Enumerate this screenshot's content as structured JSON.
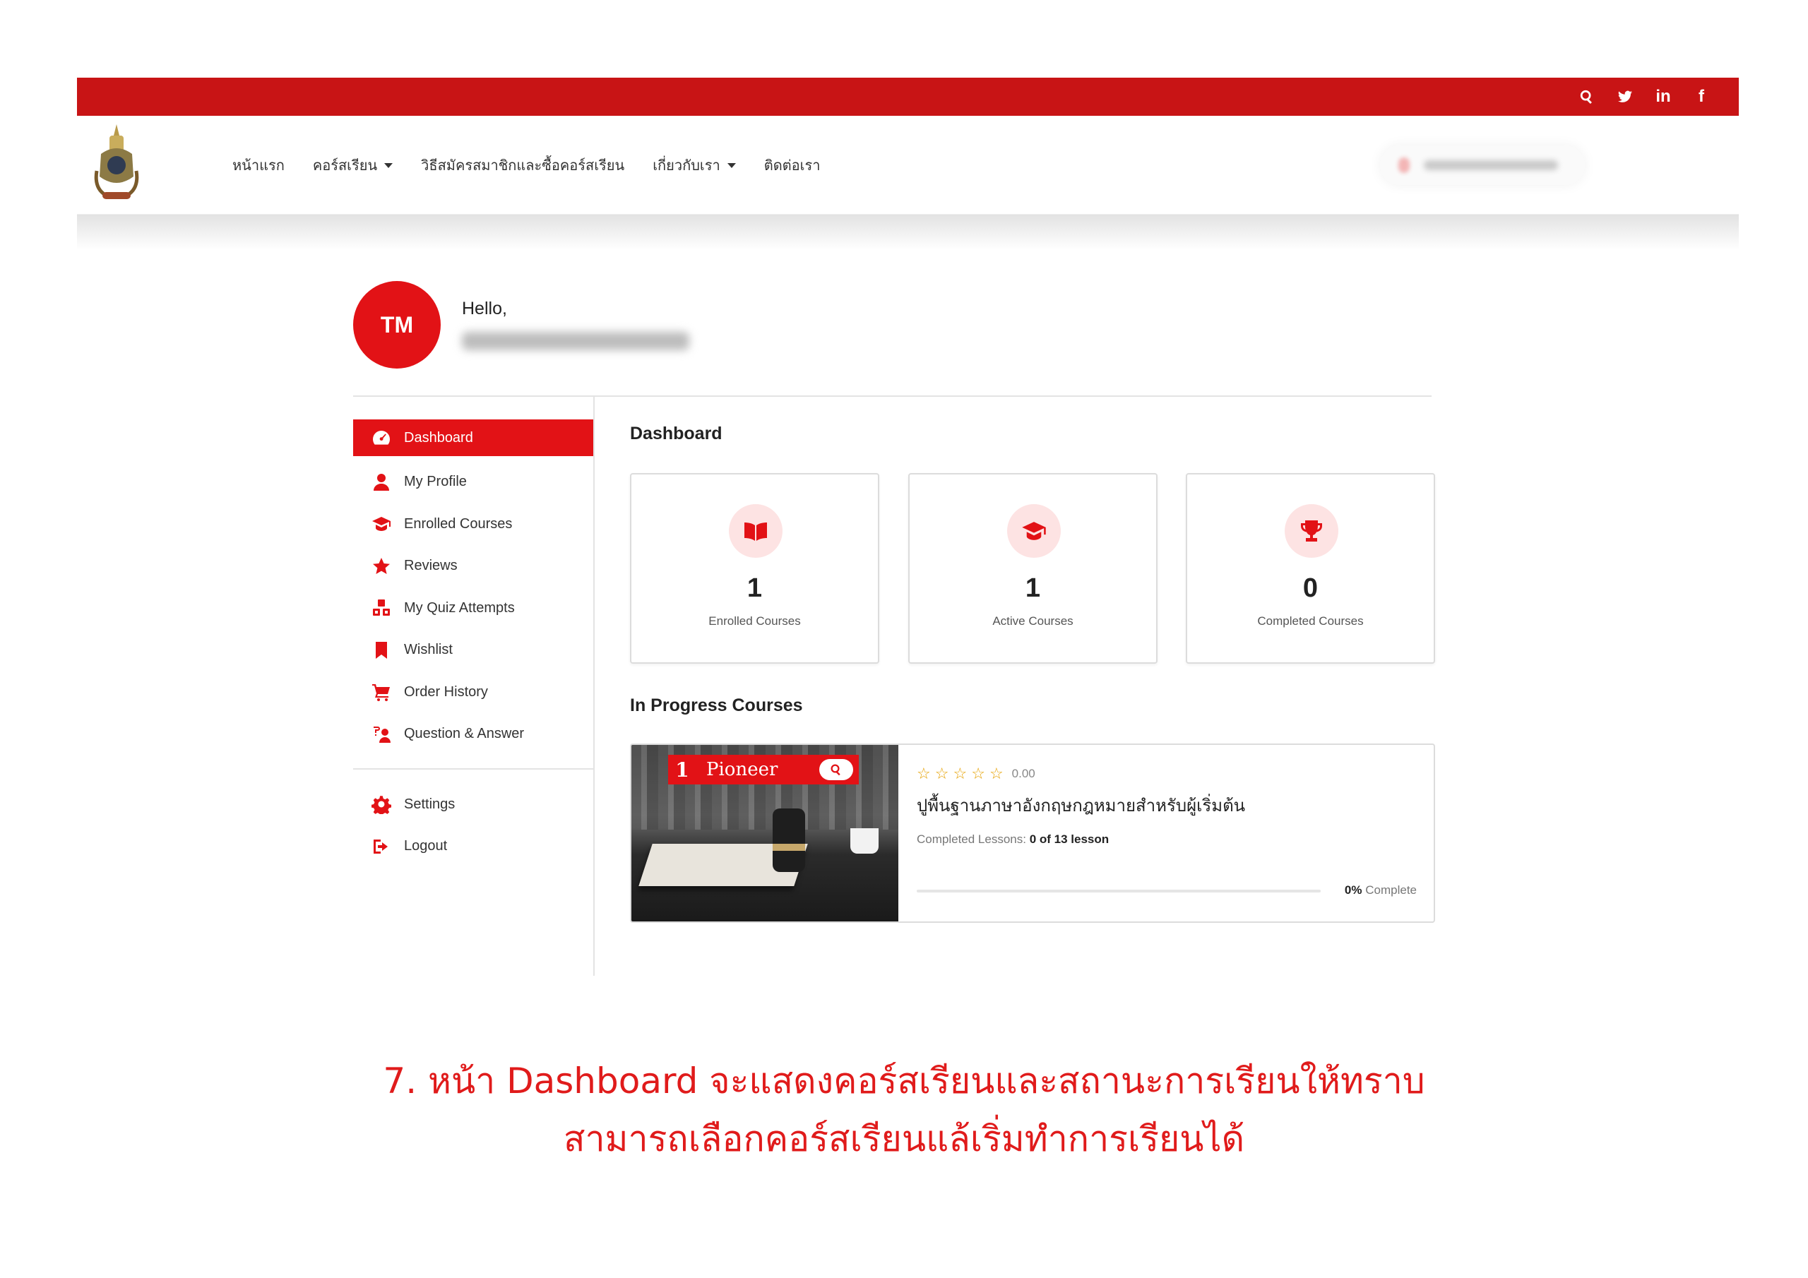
{
  "colors": {
    "brand_red": "#c81415",
    "accent_red": "#e21216",
    "star": "#e6a100"
  },
  "topbar": {
    "icons": [
      "search-icon",
      "twitter-icon",
      "linkedin-icon",
      "facebook-icon"
    ],
    "linkedin_text": "in",
    "facebook_text": "f"
  },
  "nav": {
    "items": [
      {
        "label": "หน้าแรก",
        "has_caret": false
      },
      {
        "label": "คอร์สเรียน",
        "has_caret": true
      },
      {
        "label": "วิธีสมัครสมาชิกและซื้อคอร์สเรียน",
        "has_caret": false
      },
      {
        "label": "เกี่ยวกับเรา",
        "has_caret": true
      },
      {
        "label": "ติดต่อเรา",
        "has_caret": false
      }
    ]
  },
  "profile": {
    "initials": "TM",
    "greeting": "Hello,"
  },
  "sidebar": {
    "items": [
      {
        "label": "Dashboard",
        "icon": "dashboard-gauge-icon"
      },
      {
        "label": "My Profile",
        "icon": "user-icon"
      },
      {
        "label": "Enrolled Courses",
        "icon": "graduation-cap-icon"
      },
      {
        "label": "Reviews",
        "icon": "star-icon"
      },
      {
        "label": "My Quiz Attempts",
        "icon": "cubes-icon"
      },
      {
        "label": "Wishlist",
        "icon": "bookmark-icon"
      },
      {
        "label": "Order History",
        "icon": "cart-icon"
      },
      {
        "label": "Question & Answer",
        "icon": "question-person-icon"
      }
    ],
    "bottom": [
      {
        "label": "Settings",
        "icon": "gear-icon"
      },
      {
        "label": "Logout",
        "icon": "logout-icon"
      }
    ]
  },
  "main": {
    "title": "Dashboard",
    "stats": [
      {
        "value": "1",
        "label": "Enrolled Courses",
        "icon": "book-open-icon"
      },
      {
        "value": "1",
        "label": "Active Courses",
        "icon": "graduation-cap-icon"
      },
      {
        "value": "0",
        "label": "Completed Courses",
        "icon": "trophy-icon"
      }
    ],
    "in_progress_title": "In Progress Courses",
    "course": {
      "banner_number": "1",
      "banner_text": "Pioneer",
      "rating": "0.00",
      "stars": 5,
      "title": "ปูพื้นฐานภาษาอังกฤษกฎหมายสำหรับผู้เริ่มต้น",
      "lessons_label": "Completed Lessons:",
      "lessons_value": "0 of 13 lesson",
      "progress_percent": "0%",
      "progress_fraction": 0,
      "progress_label": "Complete"
    }
  },
  "caption": {
    "line1": "7. หน้า Dashboard จะแสดงคอร์สเรียนและสถานะการเรียนให้ทราบ",
    "line2": "สามารถเลือกคอร์สเรียนแล้เริ่มทำการเรียนได้"
  }
}
